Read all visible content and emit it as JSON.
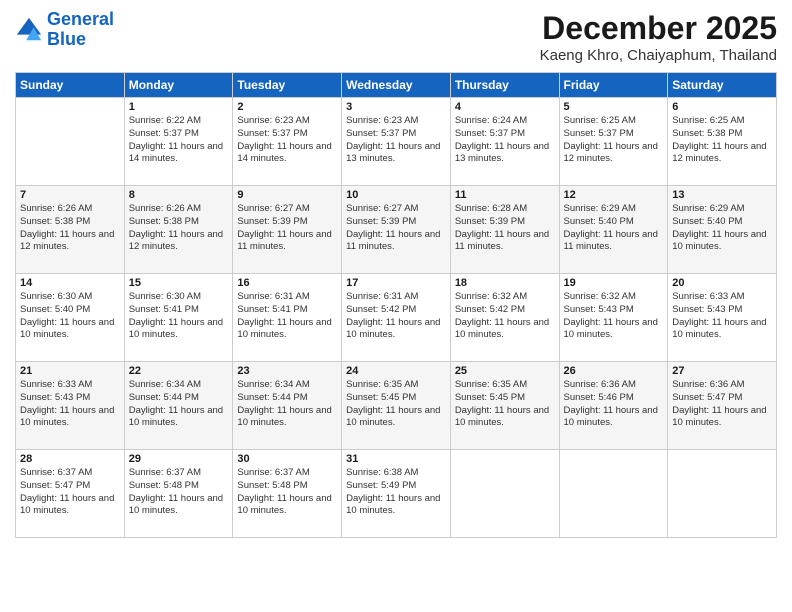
{
  "header": {
    "logo_line1": "General",
    "logo_line2": "Blue",
    "main_title": "December 2025",
    "subtitle": "Kaeng Khro, Chaiyaphum, Thailand"
  },
  "days_of_week": [
    "Sunday",
    "Monday",
    "Tuesday",
    "Wednesday",
    "Thursday",
    "Friday",
    "Saturday"
  ],
  "weeks": [
    [
      {
        "day": "",
        "sunrise": "",
        "sunset": "",
        "daylight": ""
      },
      {
        "day": "1",
        "sunrise": "Sunrise: 6:22 AM",
        "sunset": "Sunset: 5:37 PM",
        "daylight": "Daylight: 11 hours and 14 minutes."
      },
      {
        "day": "2",
        "sunrise": "Sunrise: 6:23 AM",
        "sunset": "Sunset: 5:37 PM",
        "daylight": "Daylight: 11 hours and 14 minutes."
      },
      {
        "day": "3",
        "sunrise": "Sunrise: 6:23 AM",
        "sunset": "Sunset: 5:37 PM",
        "daylight": "Daylight: 11 hours and 13 minutes."
      },
      {
        "day": "4",
        "sunrise": "Sunrise: 6:24 AM",
        "sunset": "Sunset: 5:37 PM",
        "daylight": "Daylight: 11 hours and 13 minutes."
      },
      {
        "day": "5",
        "sunrise": "Sunrise: 6:25 AM",
        "sunset": "Sunset: 5:37 PM",
        "daylight": "Daylight: 11 hours and 12 minutes."
      },
      {
        "day": "6",
        "sunrise": "Sunrise: 6:25 AM",
        "sunset": "Sunset: 5:38 PM",
        "daylight": "Daylight: 11 hours and 12 minutes."
      }
    ],
    [
      {
        "day": "7",
        "sunrise": "Sunrise: 6:26 AM",
        "sunset": "Sunset: 5:38 PM",
        "daylight": "Daylight: 11 hours and 12 minutes."
      },
      {
        "day": "8",
        "sunrise": "Sunrise: 6:26 AM",
        "sunset": "Sunset: 5:38 PM",
        "daylight": "Daylight: 11 hours and 12 minutes."
      },
      {
        "day": "9",
        "sunrise": "Sunrise: 6:27 AM",
        "sunset": "Sunset: 5:39 PM",
        "daylight": "Daylight: 11 hours and 11 minutes."
      },
      {
        "day": "10",
        "sunrise": "Sunrise: 6:27 AM",
        "sunset": "Sunset: 5:39 PM",
        "daylight": "Daylight: 11 hours and 11 minutes."
      },
      {
        "day": "11",
        "sunrise": "Sunrise: 6:28 AM",
        "sunset": "Sunset: 5:39 PM",
        "daylight": "Daylight: 11 hours and 11 minutes."
      },
      {
        "day": "12",
        "sunrise": "Sunrise: 6:29 AM",
        "sunset": "Sunset: 5:40 PM",
        "daylight": "Daylight: 11 hours and 11 minutes."
      },
      {
        "day": "13",
        "sunrise": "Sunrise: 6:29 AM",
        "sunset": "Sunset: 5:40 PM",
        "daylight": "Daylight: 11 hours and 10 minutes."
      }
    ],
    [
      {
        "day": "14",
        "sunrise": "Sunrise: 6:30 AM",
        "sunset": "Sunset: 5:40 PM",
        "daylight": "Daylight: 11 hours and 10 minutes."
      },
      {
        "day": "15",
        "sunrise": "Sunrise: 6:30 AM",
        "sunset": "Sunset: 5:41 PM",
        "daylight": "Daylight: 11 hours and 10 minutes."
      },
      {
        "day": "16",
        "sunrise": "Sunrise: 6:31 AM",
        "sunset": "Sunset: 5:41 PM",
        "daylight": "Daylight: 11 hours and 10 minutes."
      },
      {
        "day": "17",
        "sunrise": "Sunrise: 6:31 AM",
        "sunset": "Sunset: 5:42 PM",
        "daylight": "Daylight: 11 hours and 10 minutes."
      },
      {
        "day": "18",
        "sunrise": "Sunrise: 6:32 AM",
        "sunset": "Sunset: 5:42 PM",
        "daylight": "Daylight: 11 hours and 10 minutes."
      },
      {
        "day": "19",
        "sunrise": "Sunrise: 6:32 AM",
        "sunset": "Sunset: 5:43 PM",
        "daylight": "Daylight: 11 hours and 10 minutes."
      },
      {
        "day": "20",
        "sunrise": "Sunrise: 6:33 AM",
        "sunset": "Sunset: 5:43 PM",
        "daylight": "Daylight: 11 hours and 10 minutes."
      }
    ],
    [
      {
        "day": "21",
        "sunrise": "Sunrise: 6:33 AM",
        "sunset": "Sunset: 5:43 PM",
        "daylight": "Daylight: 11 hours and 10 minutes."
      },
      {
        "day": "22",
        "sunrise": "Sunrise: 6:34 AM",
        "sunset": "Sunset: 5:44 PM",
        "daylight": "Daylight: 11 hours and 10 minutes."
      },
      {
        "day": "23",
        "sunrise": "Sunrise: 6:34 AM",
        "sunset": "Sunset: 5:44 PM",
        "daylight": "Daylight: 11 hours and 10 minutes."
      },
      {
        "day": "24",
        "sunrise": "Sunrise: 6:35 AM",
        "sunset": "Sunset: 5:45 PM",
        "daylight": "Daylight: 11 hours and 10 minutes."
      },
      {
        "day": "25",
        "sunrise": "Sunrise: 6:35 AM",
        "sunset": "Sunset: 5:45 PM",
        "daylight": "Daylight: 11 hours and 10 minutes."
      },
      {
        "day": "26",
        "sunrise": "Sunrise: 6:36 AM",
        "sunset": "Sunset: 5:46 PM",
        "daylight": "Daylight: 11 hours and 10 minutes."
      },
      {
        "day": "27",
        "sunrise": "Sunrise: 6:36 AM",
        "sunset": "Sunset: 5:47 PM",
        "daylight": "Daylight: 11 hours and 10 minutes."
      }
    ],
    [
      {
        "day": "28",
        "sunrise": "Sunrise: 6:37 AM",
        "sunset": "Sunset: 5:47 PM",
        "daylight": "Daylight: 11 hours and 10 minutes."
      },
      {
        "day": "29",
        "sunrise": "Sunrise: 6:37 AM",
        "sunset": "Sunset: 5:48 PM",
        "daylight": "Daylight: 11 hours and 10 minutes."
      },
      {
        "day": "30",
        "sunrise": "Sunrise: 6:37 AM",
        "sunset": "Sunset: 5:48 PM",
        "daylight": "Daylight: 11 hours and 10 minutes."
      },
      {
        "day": "31",
        "sunrise": "Sunrise: 6:38 AM",
        "sunset": "Sunset: 5:49 PM",
        "daylight": "Daylight: 11 hours and 10 minutes."
      },
      {
        "day": "",
        "sunrise": "",
        "sunset": "",
        "daylight": ""
      },
      {
        "day": "",
        "sunrise": "",
        "sunset": "",
        "daylight": ""
      },
      {
        "day": "",
        "sunrise": "",
        "sunset": "",
        "daylight": ""
      }
    ]
  ]
}
